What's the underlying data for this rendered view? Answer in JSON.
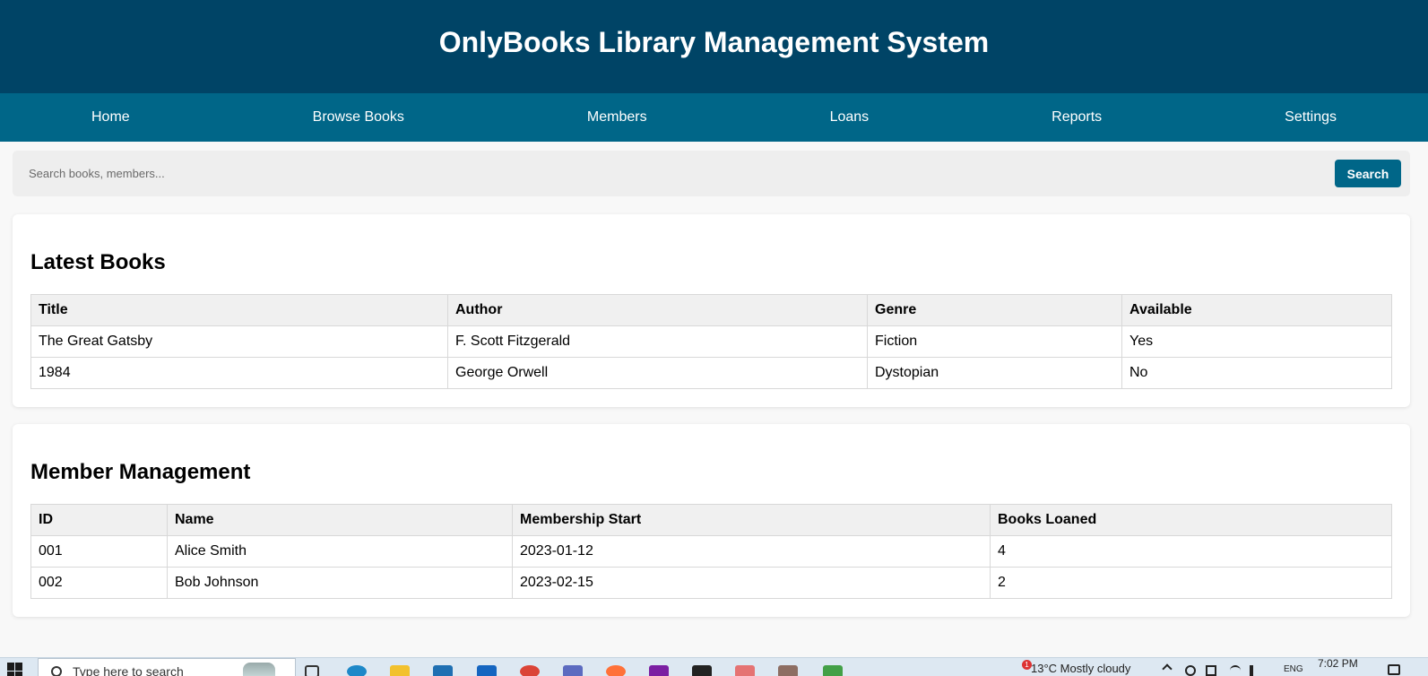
{
  "header": {
    "title": "OnlyBooks Library Management System"
  },
  "nav": {
    "items": [
      {
        "label": "Home"
      },
      {
        "label": "Browse Books"
      },
      {
        "label": "Members"
      },
      {
        "label": "Loans"
      },
      {
        "label": "Reports"
      },
      {
        "label": "Settings"
      }
    ]
  },
  "search": {
    "placeholder": "Search books, members...",
    "value": "",
    "button_label": "Search"
  },
  "latest_books": {
    "heading": "Latest Books",
    "columns": [
      "Title",
      "Author",
      "Genre",
      "Available"
    ],
    "rows": [
      [
        "The Great Gatsby",
        "F. Scott Fitzgerald",
        "Fiction",
        "Yes"
      ],
      [
        "1984",
        "George Orwell",
        "Dystopian",
        "No"
      ]
    ]
  },
  "members": {
    "heading": "Member Management",
    "columns": [
      "ID",
      "Name",
      "Membership Start",
      "Books Loaned"
    ],
    "rows": [
      [
        "001",
        "Alice Smith",
        "2023-01-12",
        "4"
      ],
      [
        "002",
        "Bob Johnson",
        "2023-02-15",
        "2"
      ]
    ]
  },
  "taskbar": {
    "search_placeholder": "Type here to search",
    "weather": "13°C  Mostly cloudy",
    "notification_count": "1",
    "language": "ENG",
    "time": "7:02 PM"
  },
  "colors": {
    "header_bg": "#004466",
    "nav_bg": "#006688",
    "button_bg": "#006688",
    "page_bg": "#f8f8f8"
  }
}
